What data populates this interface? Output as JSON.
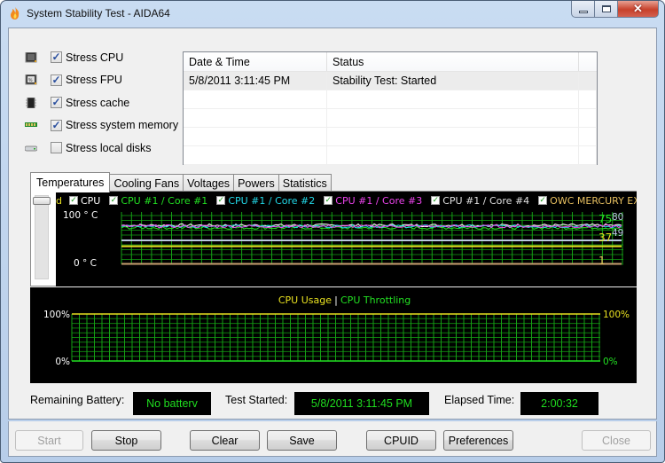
{
  "window": {
    "title": "System Stability Test - AIDA64",
    "controls": [
      "minimize",
      "maximize",
      "close"
    ]
  },
  "stress_options": [
    {
      "label": "Stress CPU",
      "checked": true,
      "icon": "cpu-chip-icon"
    },
    {
      "label": "Stress FPU",
      "checked": true,
      "icon": "fpu-chip-icon"
    },
    {
      "label": "Stress cache",
      "checked": true,
      "icon": "cache-chip-icon"
    },
    {
      "label": "Stress system memory",
      "checked": true,
      "icon": "memory-module-icon"
    },
    {
      "label": "Stress local disks",
      "checked": false,
      "icon": "hard-disk-icon"
    }
  ],
  "log": {
    "columns": [
      "Date & Time",
      "Status"
    ],
    "rows": [
      {
        "datetime": "5/8/2011 3:11:45 PM",
        "status": "Stability Test: Started"
      }
    ]
  },
  "tabs": [
    {
      "label": "Temperatures",
      "active": true
    },
    {
      "label": "Cooling Fans",
      "active": false
    },
    {
      "label": "Voltages",
      "active": false
    },
    {
      "label": "Powers",
      "active": false
    },
    {
      "label": "Statistics",
      "active": false
    }
  ],
  "temperature_graph": {
    "legend_prefix": "d",
    "legend": [
      {
        "label": "CPU",
        "color": "#ffffff"
      },
      {
        "label": "CPU #1 / Core #1",
        "color": "#22e022"
      },
      {
        "label": "CPU #1 / Core #2",
        "color": "#22d8e8"
      },
      {
        "label": "CPU #1 / Core #3",
        "color": "#ee44ee"
      },
      {
        "label": "CPU #1 / Core #4",
        "color": "#e0e0e0"
      },
      {
        "label": "OWC MERCURY EXTREME",
        "color": "#e8c060"
      }
    ],
    "y_max_label": "100 ° C",
    "y_min_label": "0 ° C",
    "right_values": [
      {
        "value": "80",
        "color": "#b8c8e0"
      },
      {
        "value": "75",
        "color": "#22e022"
      },
      {
        "value": "49",
        "color": "#b8c8e0"
      },
      {
        "value": "37",
        "color": "#e8e020"
      },
      {
        "value": "1",
        "color": "#e8c060"
      }
    ]
  },
  "usage_graph": {
    "title_left": "CPU Usage",
    "separator": "|",
    "title_right": "CPU Throttling",
    "left_max": "100%",
    "left_min": "0%",
    "right_max": "100%",
    "right_min": "0%",
    "colors": {
      "usage": "#e8e020",
      "throttling": "#22e022"
    }
  },
  "status": {
    "battery_label": "Remaining Battery:",
    "battery_value": "No batterv",
    "started_label": "Test Started:",
    "started_value": "5/8/2011 3:11:45 PM",
    "elapsed_label": "Elapsed Time:",
    "elapsed_value": "2:00:32"
  },
  "buttons": {
    "start": "Start",
    "stop": "Stop",
    "clear": "Clear",
    "save": "Save",
    "cpuid": "CPUID",
    "preferences": "Preferences",
    "close": "Close"
  },
  "chart_data": [
    {
      "type": "line",
      "title": "Temperatures",
      "ylabel": "° C",
      "ylim": [
        0,
        100
      ],
      "series": [
        {
          "name": "CPU",
          "current": 80,
          "approx_level": 80
        },
        {
          "name": "CPU #1 / Core #1",
          "current": 75,
          "approx_level": 75
        },
        {
          "name": "CPU #1 / Core #2",
          "approx_level": 78
        },
        {
          "name": "CPU #1 / Core #3",
          "approx_level": 78
        },
        {
          "name": "CPU #1 / Core #4",
          "current": 49,
          "approx_level": 49
        },
        {
          "name": "OWC MERCURY EXTREME",
          "current": 37,
          "approx_level": 37
        },
        {
          "name": "d",
          "current": 1,
          "approx_level": 1
        }
      ]
    },
    {
      "type": "line",
      "title": "CPU Usage | CPU Throttling",
      "ylim": [
        0,
        100
      ],
      "series": [
        {
          "name": "CPU Usage",
          "value_percent": 100
        },
        {
          "name": "CPU Throttling",
          "value_percent": 0
        }
      ]
    }
  ]
}
